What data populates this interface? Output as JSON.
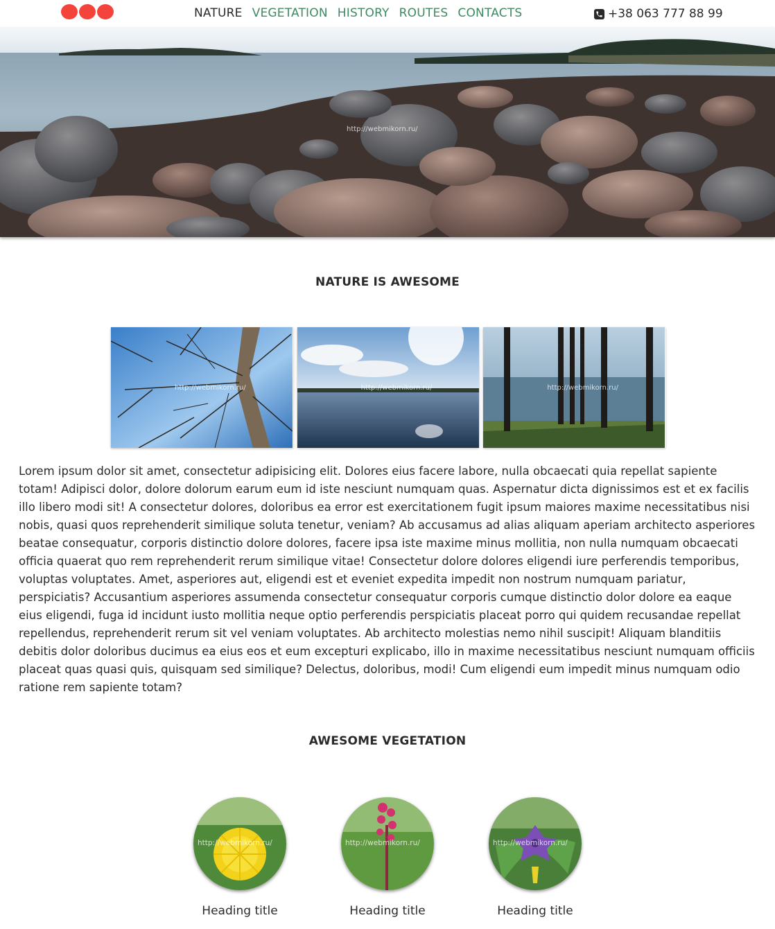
{
  "header": {
    "nav": [
      {
        "label": "NATURE",
        "active": true
      },
      {
        "label": "VEGETATION",
        "active": false
      },
      {
        "label": "HISTORY",
        "active": false
      },
      {
        "label": "ROUTES",
        "active": false
      },
      {
        "label": "CONTACTS",
        "active": false
      }
    ],
    "phone": "+38 063 777 88 99"
  },
  "watermark": "http://webmikorn.ru/",
  "sections": {
    "nature_title": "NATURE IS AWESOME",
    "vegetation_title": "AWESOME VEGETATION"
  },
  "body_text": "Lorem ipsum dolor sit amet, consectetur adipisicing elit. Dolores eius facere labore, nulla obcaecati quia repellat sapiente totam! Adipisci dolor, dolore dolorum earum eum id iste nesciunt numquam quas. Aspernatur dicta dignissimos est et ex facilis illo libero modi sit! A consectetur dolores, doloribus ea error est exercitationem fugit ipsum maiores maxime necessitatibus nisi nobis, quasi quos reprehenderit similique soluta tenetur, veniam? Ab accusamus ad alias aliquam aperiam architecto asperiores beatae consequatur, corporis distinctio dolore dolores, facere ipsa iste maxime minus mollitia, non nulla numquam obcaecati officia quaerat quo rem reprehenderit rerum similique vitae! Consectetur dolore dolores eligendi iure perferendis temporibus, voluptas voluptates. Amet, asperiores aut, eligendi est et eveniet expedita impedit non nostrum numquam pariatur, perspiciatis? Accusantium asperiores assumenda consectetur consequatur corporis cumque distinctio dolor dolore ea eaque eius eligendi, fuga id incidunt iusto mollitia neque optio perferendis perspiciatis placeat porro qui quidem recusandae repellat repellendus, reprehenderit rerum sit vel veniam voluptates. Ab architecto molestias nemo nihil suscipit! Aliquam blanditiis debitis dolor doloribus ducimus ea eius eos et eum excepturi explicabo, illo in maxime necessitatibus nesciunt numquam officiis placeat quas quasi quis, quisquam sed similique? Delectus, doloribus, modi! Cum eligendi eum impedit minus numquam odio ratione rem sapiente totam?",
  "vegetation": [
    {
      "title": "Heading title"
    },
    {
      "title": "Heading title"
    },
    {
      "title": "Heading title"
    }
  ],
  "colors": {
    "logo": "#f4433b",
    "nav_link": "#3e8a62",
    "nav_active": "#2a2a2a",
    "text": "#2a2a2a"
  }
}
